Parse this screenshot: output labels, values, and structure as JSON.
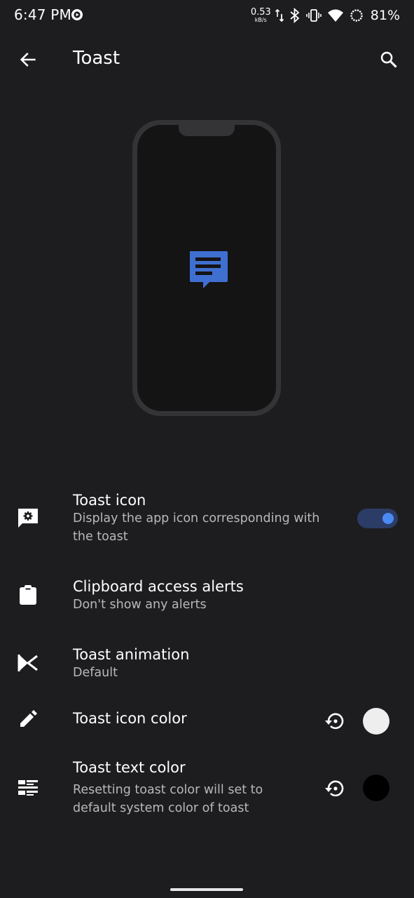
{
  "status_bar": {
    "time": "6:47 PM",
    "net_speed_value": "0.53",
    "net_speed_unit": "kB/s",
    "battery": "81%"
  },
  "app_bar": {
    "title": "Toast",
    "back_icon": "arrow-back-icon",
    "search_icon": "search-icon"
  },
  "preview": {
    "toast_icon": "message-text-icon",
    "accent": "#3f6fd1"
  },
  "settings": [
    {
      "id": "toast-icon",
      "icon": "chat-settings-icon",
      "title": "Toast icon",
      "subtitle_line1": "Display the app icon corresponding with",
      "subtitle_line2": "the toast",
      "toggle_on": true
    },
    {
      "id": "clipboard-alerts",
      "icon": "clipboard-icon",
      "title": "Clipboard access alerts",
      "subtitle_line1": "Don't show any alerts"
    },
    {
      "id": "toast-animation",
      "icon": "animation-icon",
      "title": "Toast animation",
      "subtitle_line1": "Default"
    },
    {
      "id": "toast-icon-color",
      "icon": "pencil-icon",
      "title": "Toast icon color",
      "color": "#eeeeee",
      "reset_icon": "reset-icon"
    },
    {
      "id": "toast-text-color",
      "icon": "text-format-icon",
      "title": "Toast text color",
      "subtitle_line1": "Resetting toast color will set to",
      "subtitle_line2": "default system color of toast",
      "color": "#000000",
      "reset_icon": "reset-icon"
    }
  ],
  "colors": {
    "background": "#1d1d1f",
    "switch_track": "#2b3c66",
    "switch_thumb": "#4a8af4"
  }
}
